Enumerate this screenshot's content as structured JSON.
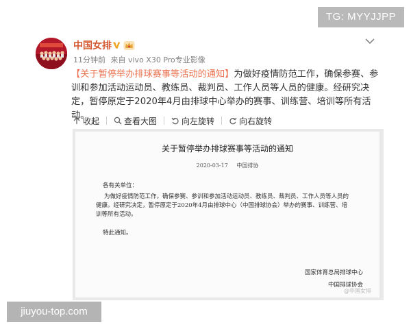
{
  "watermarks": {
    "top": "TG: MYYJJPP",
    "bottom": "jiuyou-top.com"
  },
  "profile": {
    "name": "中国女排",
    "time": "11分钟前",
    "source": "来自 vivo X30 Pro专业影像"
  },
  "post": {
    "link_text": "【关于暂停举办排球赛事等活动的通知】",
    "body": "为做好疫情防范工作，确保参赛、参训和参加活动运动员、教练员、裁判员、工作人员等人员的健康。经研究决定，暂停原定于2020年4月由排球中心举办的赛事、训练营、培训等所有活动。"
  },
  "actions": {
    "collapse": "收起",
    "view_large": "查看大图",
    "rotate_left": "向左旋转",
    "rotate_right": "向右旋转"
  },
  "doc": {
    "title": "关于暂停举办排球赛事等活动的通知",
    "date": "2020-03-17",
    "publisher": "中国排协",
    "salutation": "各有关单位：",
    "body": "为做好疫情防范工作，确保参赛、参训和参加活动运动员、教练员、裁判员、工作人员等人员的健康。经研究决定，暂停原定于2020年4月由排球中心（中国排球协会）举办的赛事、训练营、培训等所有活动。",
    "closing": "特此通知。",
    "sign_1": "国家体育总局排球中心",
    "sign_2": "中国排球协会",
    "watermark": "@中国女排"
  },
  "colors": {
    "name": "#d4582f",
    "link": "#eb7350",
    "verify": "#f0a525",
    "avatar_bg": "#b3182a"
  },
  "icons": [
    "verified-v-icon",
    "vip-crown-icon",
    "chevron-down-icon",
    "collapse-arrow-icon",
    "magnifier-icon",
    "rotate-left-icon",
    "rotate-right-icon"
  ]
}
